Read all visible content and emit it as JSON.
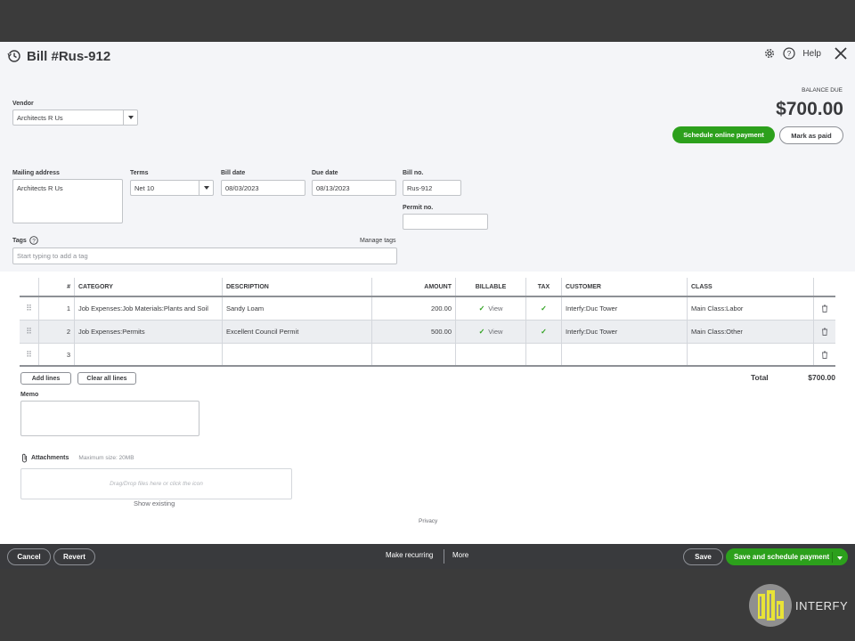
{
  "header": {
    "title": "Bill #Rus-912",
    "help_label": "Help"
  },
  "balance": {
    "label": "BALANCE DUE",
    "amount": "$700.00",
    "schedule_label": "Schedule online payment",
    "mark_paid_label": "Mark as paid"
  },
  "form": {
    "vendor_label": "Vendor",
    "vendor_value": "Architects R Us",
    "mailing_label": "Mailing address",
    "mailing_value": "Architects R Us",
    "terms_label": "Terms",
    "terms_value": "Net 10",
    "bill_date_label": "Bill date",
    "bill_date_value": "08/03/2023",
    "due_date_label": "Due date",
    "due_date_value": "08/13/2023",
    "bill_no_label": "Bill no.",
    "bill_no_value": "Rus-912",
    "permit_label": "Permit no.",
    "permit_value": "",
    "tags_label": "Tags",
    "manage_tags_label": "Manage tags",
    "tags_placeholder": "Start typing to add a tag"
  },
  "table": {
    "headers": {
      "num": "#",
      "category": "CATEGORY",
      "description": "DESCRIPTION",
      "amount": "AMOUNT",
      "billable": "BILLABLE",
      "tax": "TAX",
      "customer": "CUSTOMER",
      "class": "CLASS"
    },
    "rows": [
      {
        "num": "1",
        "category": "Job Expenses:Job Materials:Plants and Soil",
        "description": "Sandy Loam",
        "amount": "200.00",
        "view": "View",
        "customer": "Interfy:Duc Tower",
        "class": "Main Class:Labor"
      },
      {
        "num": "2",
        "category": "Job Expenses:Permits",
        "description": "Excellent Council Permit",
        "amount": "500.00",
        "view": "View",
        "customer": "Interfy:Duc Tower",
        "class": "Main Class:Other"
      },
      {
        "num": "3"
      }
    ],
    "add_lines_label": "Add lines",
    "clear_lines_label": "Clear all lines",
    "total_label": "Total",
    "total_value": "$700.00"
  },
  "memo": {
    "label": "Memo"
  },
  "attachments": {
    "label": "Attachments",
    "max_size": "Maximum size: 20MB",
    "drop_hint": "Drag/Drop files here or click the icon",
    "show_existing": "Show existing"
  },
  "privacy_label": "Privacy",
  "footer": {
    "cancel": "Cancel",
    "revert": "Revert",
    "make_recurring": "Make recurring",
    "more": "More",
    "save": "Save",
    "save_schedule": "Save and schedule payment"
  },
  "watermark": {
    "text": "INTERFY"
  },
  "colors": {
    "accent_green": "#2ca01c",
    "footer_bg": "#393a3d",
    "page_bg": "#3b3b3b"
  }
}
